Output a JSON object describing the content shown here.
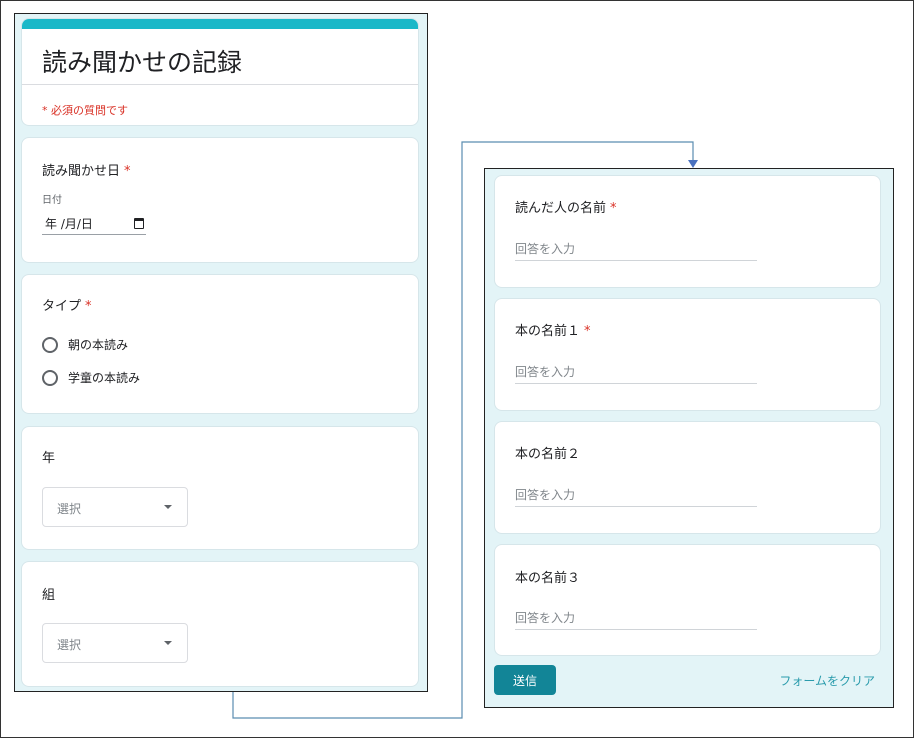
{
  "form_left": {
    "title": "読み聞かせの記録",
    "required_note": "* 必須の質問です",
    "q_date": {
      "label": "読み聞かせ日",
      "required": "*",
      "sub_label": "日付",
      "value": "年 /月/日"
    },
    "q_type": {
      "label": "タイプ",
      "required": "*",
      "options": [
        "朝の本読み",
        "学童の本読み"
      ]
    },
    "q_year": {
      "label": "年",
      "placeholder": "選択"
    },
    "q_class": {
      "label": "組",
      "placeholder": "選択"
    }
  },
  "form_right": {
    "q_reader": {
      "label": "読んだ人の名前",
      "required": "*",
      "placeholder": "回答を入力"
    },
    "q_book1": {
      "label": "本の名前１",
      "required": "*",
      "placeholder": "回答を入力"
    },
    "q_book2": {
      "label": "本の名前２",
      "placeholder": "回答を入力"
    },
    "q_book3": {
      "label": "本の名前３",
      "placeholder": "回答を入力"
    },
    "submit_label": "送信",
    "clear_label": "フォームをクリア"
  },
  "colors": {
    "accent": "#1ab8c8",
    "panel_bg": "#e3f4f7",
    "button": "#128597",
    "required": "#d93025",
    "link": "#2a9bac",
    "connector": "#5b8db0"
  }
}
